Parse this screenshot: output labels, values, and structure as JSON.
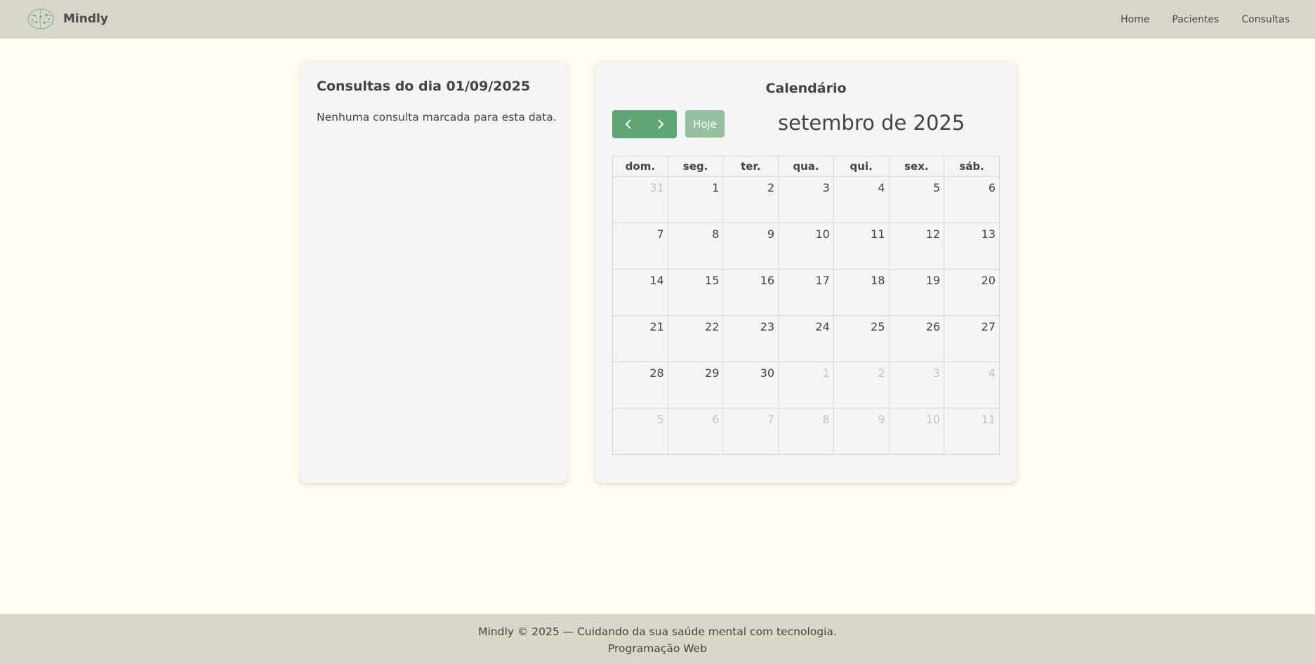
{
  "nav": {
    "brand": "Mindly",
    "links": [
      "Home",
      "Pacientes",
      "Consultas"
    ]
  },
  "day_panel": {
    "title": "Consultas do dia 01/09/2025",
    "empty_message": "Nenhuma consulta marcada para esta data."
  },
  "calendar": {
    "title": "Calendário",
    "today_label": "Hoje",
    "month_label": "setembro de 2025",
    "weekdays": [
      "dom.",
      "seg.",
      "ter.",
      "qua.",
      "qui.",
      "sex.",
      "sáb."
    ],
    "weeks": [
      [
        {
          "d": "31",
          "o": true
        },
        {
          "d": "1"
        },
        {
          "d": "2"
        },
        {
          "d": "3"
        },
        {
          "d": "4"
        },
        {
          "d": "5"
        },
        {
          "d": "6"
        }
      ],
      [
        {
          "d": "7"
        },
        {
          "d": "8"
        },
        {
          "d": "9"
        },
        {
          "d": "10"
        },
        {
          "d": "11"
        },
        {
          "d": "12"
        },
        {
          "d": "13"
        }
      ],
      [
        {
          "d": "14"
        },
        {
          "d": "15"
        },
        {
          "d": "16"
        },
        {
          "d": "17"
        },
        {
          "d": "18"
        },
        {
          "d": "19"
        },
        {
          "d": "20"
        }
      ],
      [
        {
          "d": "21"
        },
        {
          "d": "22"
        },
        {
          "d": "23"
        },
        {
          "d": "24"
        },
        {
          "d": "25"
        },
        {
          "d": "26"
        },
        {
          "d": "27"
        }
      ],
      [
        {
          "d": "28"
        },
        {
          "d": "29"
        },
        {
          "d": "30"
        },
        {
          "d": "1",
          "o": true
        },
        {
          "d": "2",
          "o": true
        },
        {
          "d": "3",
          "o": true
        },
        {
          "d": "4",
          "o": true
        }
      ],
      [
        {
          "d": "5",
          "o": true
        },
        {
          "d": "6",
          "o": true
        },
        {
          "d": "7",
          "o": true
        },
        {
          "d": "8",
          "o": true
        },
        {
          "d": "9",
          "o": true
        },
        {
          "d": "10",
          "o": true
        },
        {
          "d": "11",
          "o": true
        }
      ]
    ],
    "icons": {
      "prev": "chevron-left-icon",
      "next": "chevron-right-icon"
    }
  },
  "footer": {
    "line1": "Mindly © 2025 — Cuidando da sua saúde mental com tecnologia.",
    "line2": "Programação Web"
  },
  "colors": {
    "accent": "#62a574",
    "accent_light": "#96c09f",
    "nav_bg": "#d9d7ca",
    "page_bg": "#fffbf3"
  }
}
